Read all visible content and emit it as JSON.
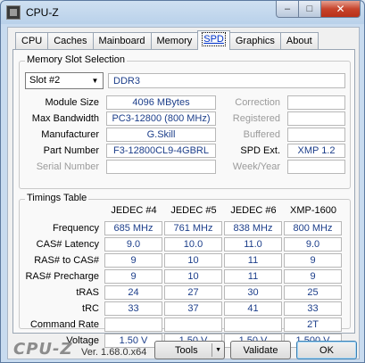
{
  "window": {
    "title": "CPU-Z",
    "controls": {
      "minimize": "–",
      "maximize": "□",
      "close": "✕"
    }
  },
  "tabs": [
    "CPU",
    "Caches",
    "Mainboard",
    "Memory",
    "SPD",
    "Graphics",
    "About"
  ],
  "active_tab": "SPD",
  "slot_group": {
    "title": "Memory Slot Selection",
    "slot_select": "Slot #2",
    "type": "DDR3",
    "rows": [
      {
        "label": "Module Size",
        "value": "4096 MBytes"
      },
      {
        "label": "Max Bandwidth",
        "value": "PC3-12800 (800 MHz)"
      },
      {
        "label": "Manufacturer",
        "value": "G.Skill"
      },
      {
        "label": "Part Number",
        "value": "F3-12800CL9-4GBRL"
      },
      {
        "label": "Serial Number",
        "value": ""
      }
    ],
    "right_rows": [
      {
        "label": "Correction",
        "value": ""
      },
      {
        "label": "Registered",
        "value": ""
      },
      {
        "label": "Buffered",
        "value": ""
      },
      {
        "label": "SPD Ext.",
        "value": "XMP 1.2"
      },
      {
        "label": "Week/Year",
        "value": ""
      }
    ]
  },
  "timings": {
    "title": "Timings Table",
    "columns": [
      "JEDEC #4",
      "JEDEC #5",
      "JEDEC #6",
      "XMP-1600"
    ],
    "rows": [
      {
        "label": "Frequency",
        "values": [
          "685 MHz",
          "761 MHz",
          "838 MHz",
          "800 MHz"
        ]
      },
      {
        "label": "CAS# Latency",
        "values": [
          "9.0",
          "10.0",
          "11.0",
          "9.0"
        ]
      },
      {
        "label": "RAS# to CAS#",
        "values": [
          "9",
          "10",
          "11",
          "9"
        ]
      },
      {
        "label": "RAS# Precharge",
        "values": [
          "9",
          "10",
          "11",
          "9"
        ]
      },
      {
        "label": "tRAS",
        "values": [
          "24",
          "27",
          "30",
          "25"
        ]
      },
      {
        "label": "tRC",
        "values": [
          "33",
          "37",
          "41",
          "33"
        ]
      },
      {
        "label": "Command Rate",
        "values": [
          "",
          "",
          "",
          "2T"
        ]
      },
      {
        "label": "Voltage",
        "values": [
          "1.50 V",
          "1.50 V",
          "1.50 V",
          "1.500 V"
        ]
      }
    ]
  },
  "footer": {
    "logo": "CPU-Z",
    "version": "Ver. 1.68.0.x64",
    "tools_label": "Tools",
    "validate_label": "Validate",
    "ok_label": "OK"
  }
}
